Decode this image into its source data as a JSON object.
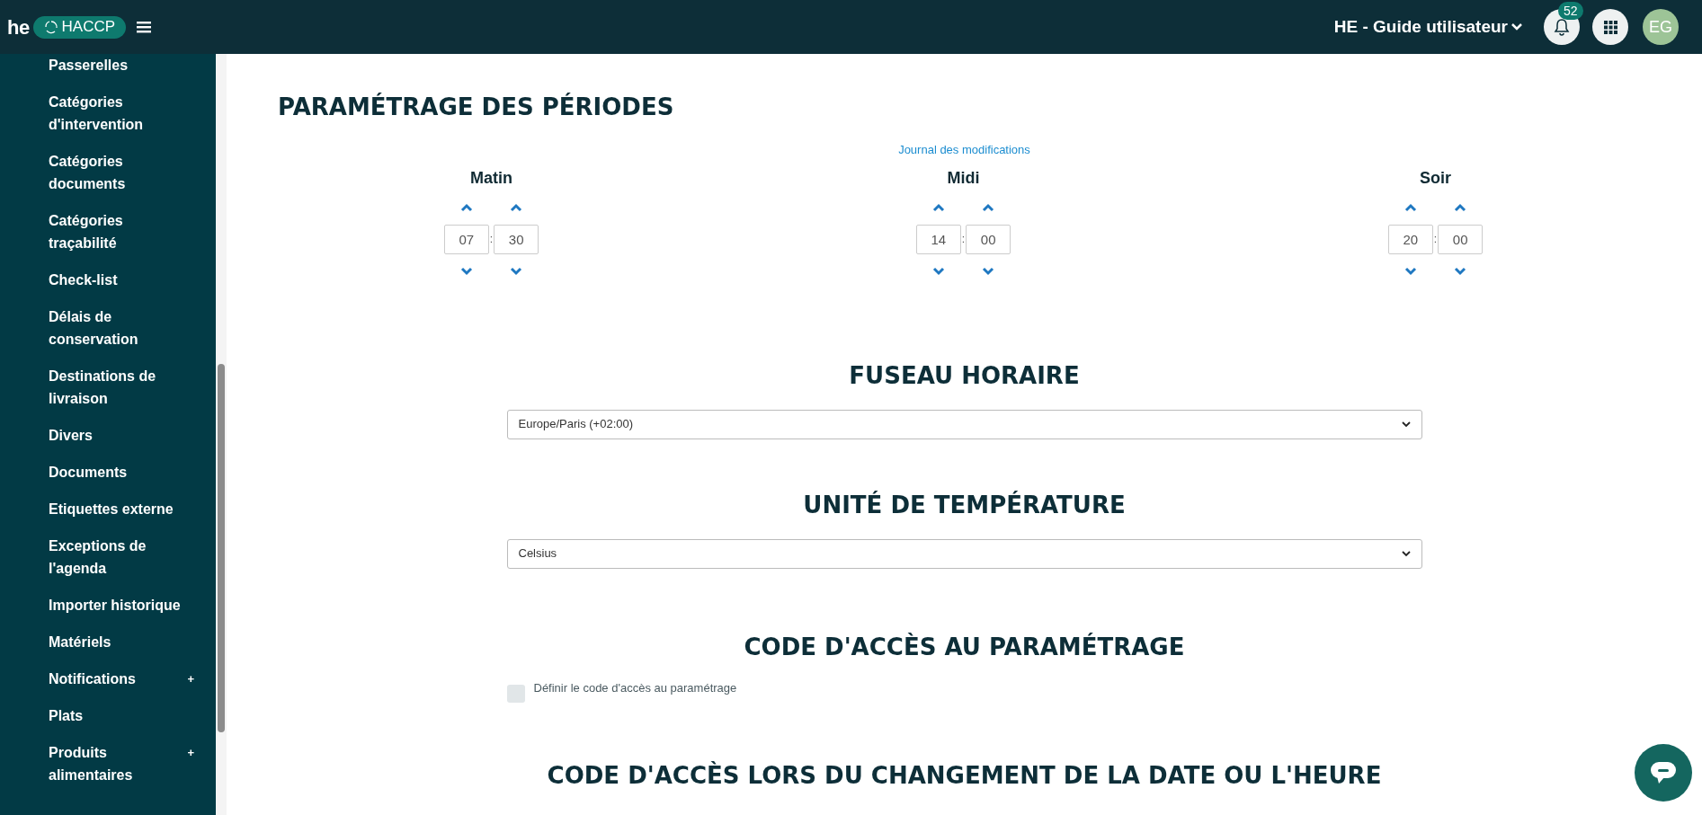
{
  "header": {
    "logo": "he",
    "app_badge": "HACCP",
    "account": "HE - Guide utilisateur",
    "notification_count": "52",
    "avatar": "EG"
  },
  "sidebar": {
    "items": [
      {
        "label": "Passerelles"
      },
      {
        "label": "Catégories d'intervention"
      },
      {
        "label": "Catégories documents"
      },
      {
        "label": "Catégories traçabilité"
      },
      {
        "label": "Check-list"
      },
      {
        "label": "Délais de conservation"
      },
      {
        "label": "Destinations de livraison"
      },
      {
        "label": "Divers"
      },
      {
        "label": "Documents"
      },
      {
        "label": "Etiquettes externe"
      },
      {
        "label": "Exceptions de l'agenda"
      },
      {
        "label": "Importer historique"
      },
      {
        "label": "Matériels"
      },
      {
        "label": "Notifications",
        "toggle": "+"
      },
      {
        "label": "Plats"
      },
      {
        "label": "Produits alimentaires",
        "toggle": "+"
      }
    ]
  },
  "periods": {
    "title": "PARAMÉTRAGE DES PÉRIODES",
    "log_link": "Journal des modifications",
    "separator": ":",
    "items": [
      {
        "label": "Matin",
        "hour": "07",
        "minute": "30"
      },
      {
        "label": "Midi",
        "hour": "14",
        "minute": "00"
      },
      {
        "label": "Soir",
        "hour": "20",
        "minute": "00"
      }
    ]
  },
  "timezone": {
    "title": "FUSEAU HORAIRE",
    "value": "Europe/Paris (+02:00)"
  },
  "temperature_unit": {
    "title": "UNITÉ DE TEMPÉRATURE",
    "value": "Celsius"
  },
  "settings_code": {
    "title": "CODE D'ACCÈS AU PARAMÉTRAGE",
    "checkbox_label": "Définir le code d'accès au paramétrage",
    "checked": false
  },
  "datetime_code": {
    "title": "CODE D'ACCÈS LORS DU CHANGEMENT DE LA DATE OU L'HEURE"
  }
}
